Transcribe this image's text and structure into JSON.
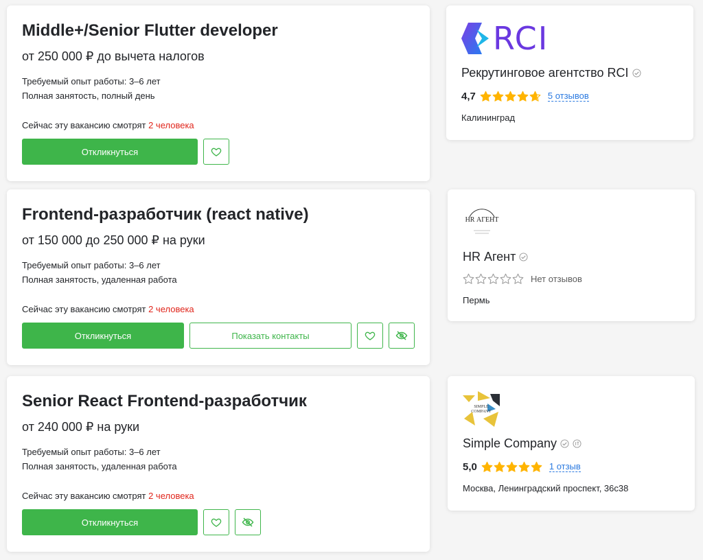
{
  "vacancies": [
    {
      "title": "Middle+/Senior Flutter developer",
      "salary": "от 250 000 ₽ до вычета налогов",
      "experience": "Требуемый опыт работы: 3–6 лет",
      "employment": "Полная занятость, полный день",
      "views_prefix": "Сейчас эту вакансию смотрят",
      "views_count": "2 человека",
      "apply_label": "Откликнуться"
    },
    {
      "title": "Frontend-разработчик (react native)",
      "salary": "от 150 000 до 250 000 ₽ на руки",
      "experience": "Требуемый опыт работы: 3–6 лет",
      "employment": "Полная занятость, удаленная работа",
      "views_prefix": "Сейчас эту вакансию смотрят",
      "views_count": "2 человека",
      "apply_label": "Откликнуться",
      "contacts_label": "Показать контакты"
    },
    {
      "title": "Senior React Frontend-разработчик",
      "salary": "от 240 000 ₽ на руки",
      "experience": "Требуемый опыт работы: 3–6 лет",
      "employment": "Полная занятость, удаленная работа",
      "views_prefix": "Сейчас эту вакансию смотрят",
      "views_count": "2 человека",
      "apply_label": "Откликнуться"
    }
  ],
  "companies": [
    {
      "logo_text": "RCI",
      "name": "Рекрутинговое агентство RCI",
      "rating": "4,7",
      "rating_value": 4.7,
      "reviews": "5 отзывов",
      "city": "Калининград"
    },
    {
      "logo_text": "HR АГЕНТ",
      "name": "HR Агент",
      "rating_value": 0,
      "reviews": "Нет отзывов",
      "city": "Пермь"
    },
    {
      "logo_text": "SIMPLE COMPANY",
      "name": "Simple Company",
      "rating": "5,0",
      "rating_value": 5,
      "reviews": "1 отзыв",
      "city": "Москва, Ленинградский проспект, 36с38"
    }
  ],
  "colors": {
    "accent": "#3eb54a",
    "highlight": "#e0251b",
    "star": "#ffb400",
    "link": "#2b7ae0"
  }
}
